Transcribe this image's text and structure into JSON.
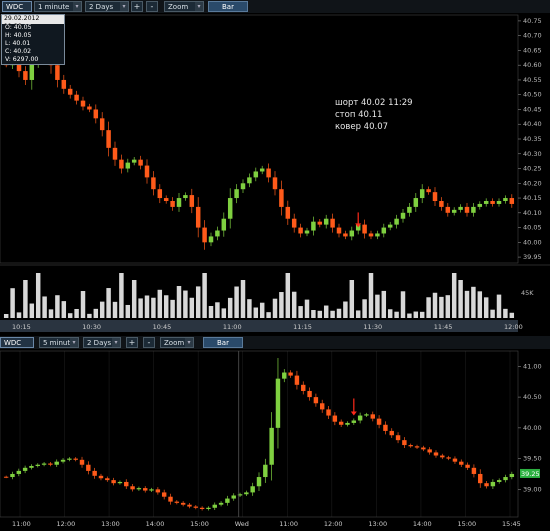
{
  "top_toolbar": {
    "symbol": "WDC",
    "interval": "1 minute",
    "range": "2 Days",
    "plus": "+",
    "minus": "-",
    "zoom": "Zoom",
    "bar": "Bar"
  },
  "bottom_toolbar": {
    "symbol": "WDC",
    "interval": "5 minutes",
    "range": "2 Days",
    "plus": "+",
    "minus": "-",
    "zoom": "Zoom",
    "bar": "Bar"
  },
  "ohlc_box": {
    "datetime": "29.02.2012 11:29...",
    "open": "O: 40.05",
    "high": "H: 40.05",
    "low": "L: 40.01",
    "close": "C: 40.02",
    "volume": "V: 6297.00"
  },
  "annotation": {
    "line1": "шорт 40.02  11:29",
    "line2": "стоп 40.11",
    "line3": "ковер 40.07"
  },
  "top_chart": {
    "y_ticks": [
      "40.75",
      "40.70",
      "40.65",
      "40.60",
      "40.55",
      "40.50",
      "40.45",
      "40.40",
      "40.35",
      "40.30",
      "40.25",
      "40.20",
      "40.15",
      "40.10",
      "40.05",
      "40.00",
      "39.95"
    ],
    "x_ticks": [
      "10:15",
      "10:30",
      "10:45",
      "11:00",
      "11:15",
      "11:30",
      "11:45",
      "12:00"
    ],
    "volume_label": "45K",
    "ymin": 39.93,
    "ymax": 40.77
  },
  "bottom_chart": {
    "y_ticks": [
      "41.00",
      "40.50",
      "40.00",
      "39.50",
      "39.00"
    ],
    "price_tag": "39.25",
    "x_ticks": [
      "11:00",
      "12:00",
      "13:00",
      "14:00",
      "15:00",
      "Wed",
      "11:00",
      "12:00",
      "13:00",
      "14:00",
      "15:00",
      "15:45"
    ],
    "ymin": 38.55,
    "ymax": 41.25
  },
  "colors": {
    "up": "#7fd040",
    "down": "#ff5a1a",
    "arrow": "#ff2a1a",
    "volume": "#d8d8d8"
  },
  "chart_data": [
    {
      "type": "candlestick",
      "title": "WDC 1 minute",
      "x_range": [
        "10:10",
        "12:00"
      ],
      "ylim": [
        39.93,
        40.77
      ],
      "close_path": [
        40.6,
        40.62,
        40.58,
        40.55,
        40.62,
        40.68,
        40.66,
        40.6,
        40.55,
        40.52,
        40.5,
        40.48,
        40.46,
        40.45,
        40.42,
        40.38,
        40.32,
        40.28,
        40.25,
        40.27,
        40.28,
        40.26,
        40.22,
        40.18,
        40.15,
        40.14,
        40.12,
        40.15,
        40.16,
        40.12,
        40.05,
        40.0,
        40.02,
        40.04,
        40.08,
        40.15,
        40.18,
        40.2,
        40.22,
        40.24,
        40.25,
        40.22,
        40.18,
        40.12,
        40.08,
        40.05,
        40.03,
        40.04,
        40.07,
        40.06,
        40.08,
        40.05,
        40.03,
        40.02,
        40.04,
        40.06,
        40.03,
        40.02,
        40.03,
        40.05,
        40.06,
        40.08,
        40.1,
        40.12,
        40.15,
        40.18,
        40.17,
        40.14,
        40.12,
        40.1,
        40.11,
        40.12,
        40.1,
        40.12,
        40.13,
        40.14,
        40.13,
        40.14,
        40.15,
        40.13
      ],
      "volume_peak": "45K",
      "marker": {
        "time": "11:29",
        "price": 40.02,
        "label": "шорт 40.02  11:29"
      }
    },
    {
      "type": "candlestick",
      "title": "WDC 5 minutes",
      "x_range": [
        "10:30",
        "15:50"
      ],
      "ylim": [
        38.55,
        41.25
      ],
      "close_path": [
        39.2,
        39.25,
        39.3,
        39.35,
        39.38,
        39.4,
        39.42,
        39.4,
        39.45,
        39.48,
        39.5,
        39.48,
        39.4,
        39.3,
        39.22,
        39.18,
        39.15,
        39.1,
        39.12,
        39.05,
        39.0,
        39.02,
        38.98,
        39.0,
        38.95,
        38.88,
        38.8,
        38.78,
        38.75,
        38.72,
        38.7,
        38.68,
        38.7,
        38.75,
        38.78,
        38.85,
        38.9,
        38.92,
        38.95,
        39.05,
        39.2,
        39.4,
        40.0,
        40.8,
        40.9,
        40.85,
        40.7,
        40.6,
        40.5,
        40.4,
        40.3,
        40.2,
        40.1,
        40.05,
        40.08,
        40.12,
        40.2,
        40.22,
        40.15,
        40.05,
        39.95,
        39.88,
        39.8,
        39.72,
        39.7,
        39.68,
        39.65,
        39.6,
        39.55,
        39.52,
        39.5,
        39.45,
        39.4,
        39.35,
        39.25,
        39.1,
        39.05,
        39.12,
        39.15,
        39.2,
        39.25
      ],
      "last_price": "39.25"
    }
  ]
}
